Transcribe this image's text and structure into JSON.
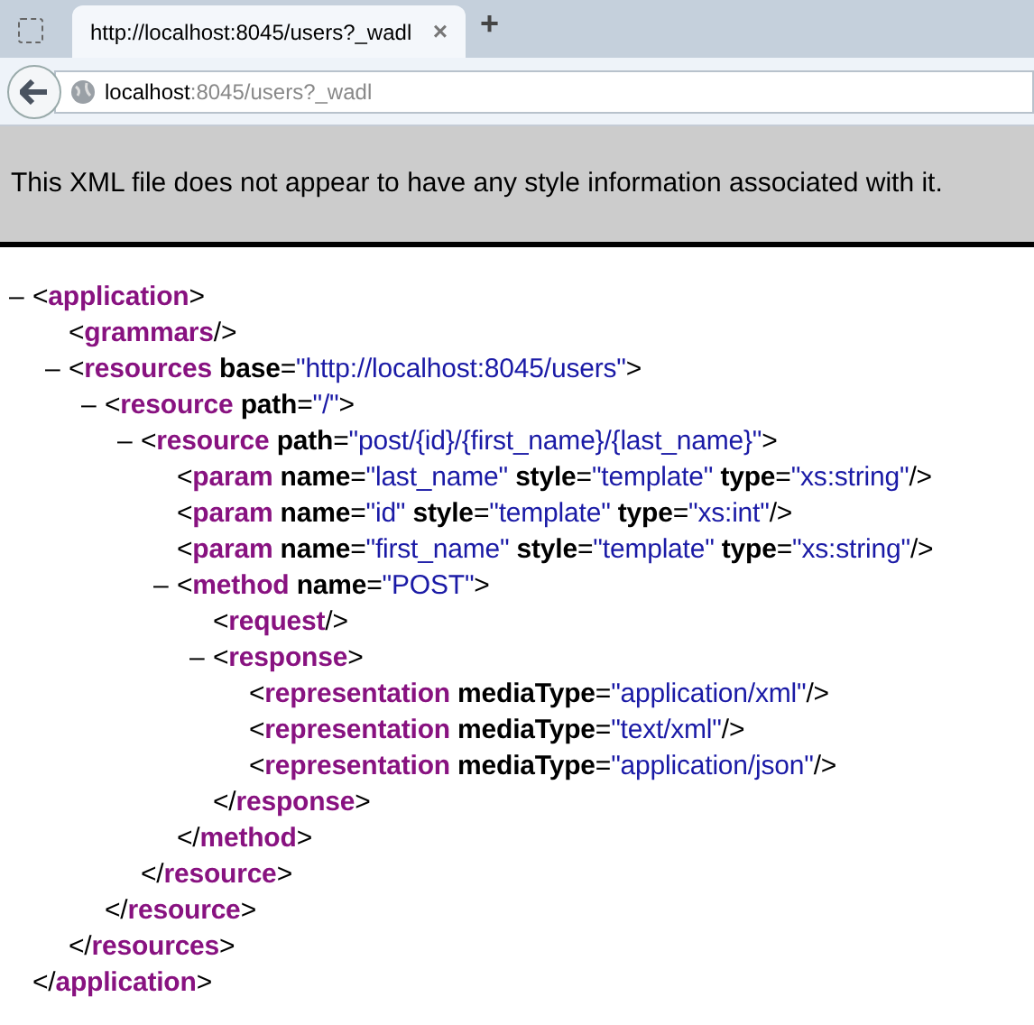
{
  "tab": {
    "title": "http://localhost:8045/users?_wadl",
    "close": "×",
    "selected": true
  },
  "new_tab": "+",
  "address": {
    "host": "localhost",
    "rest": ":8045/users?_wadl"
  },
  "info_bar": "This XML file does not appear to have any style information associated with it.",
  "tree": [
    {
      "toggle": "–",
      "tokens": [
        {
          "kind": "punct",
          "text": "<"
        },
        {
          "kind": "tag",
          "text": "application"
        },
        {
          "kind": "punct",
          "text": ">"
        }
      ],
      "end": [
        {
          "kind": "punct",
          "text": "</"
        },
        {
          "kind": "tag",
          "text": "application"
        },
        {
          "kind": "punct",
          "text": ">"
        }
      ],
      "children": [
        {
          "tokens": [
            {
              "kind": "punct",
              "text": "<"
            },
            {
              "kind": "tag",
              "text": "grammars"
            },
            {
              "kind": "punct",
              "text": "/>"
            }
          ]
        },
        {
          "toggle": "–",
          "tokens": [
            {
              "kind": "punct",
              "text": "<"
            },
            {
              "kind": "tag",
              "text": "resources"
            },
            {
              "kind": "attr",
              "text": "base"
            },
            {
              "kind": "punct",
              "text": "="
            },
            {
              "kind": "value",
              "text": "\"http://localhost:8045/users\""
            },
            {
              "kind": "punct",
              "text": ">"
            }
          ],
          "end": [
            {
              "kind": "punct",
              "text": "</"
            },
            {
              "kind": "tag",
              "text": "resources"
            },
            {
              "kind": "punct",
              "text": ">"
            }
          ],
          "children": [
            {
              "toggle": "–",
              "tokens": [
                {
                  "kind": "punct",
                  "text": "<"
                },
                {
                  "kind": "tag",
                  "text": "resource"
                },
                {
                  "kind": "attr",
                  "text": "path"
                },
                {
                  "kind": "punct",
                  "text": "="
                },
                {
                  "kind": "value",
                  "text": "\"/\""
                },
                {
                  "kind": "punct",
                  "text": ">"
                }
              ],
              "end": [
                {
                  "kind": "punct",
                  "text": "</"
                },
                {
                  "kind": "tag",
                  "text": "resource"
                },
                {
                  "kind": "punct",
                  "text": ">"
                }
              ],
              "children": [
                {
                  "toggle": "–",
                  "tokens": [
                    {
                      "kind": "punct",
                      "text": "<"
                    },
                    {
                      "kind": "tag",
                      "text": "resource"
                    },
                    {
                      "kind": "attr",
                      "text": "path"
                    },
                    {
                      "kind": "punct",
                      "text": "="
                    },
                    {
                      "kind": "value",
                      "text": "\"post/{id}/{first_name}/{last_name}\""
                    },
                    {
                      "kind": "punct",
                      "text": ">"
                    }
                  ],
                  "end": [
                    {
                      "kind": "punct",
                      "text": "</"
                    },
                    {
                      "kind": "tag",
                      "text": "resource"
                    },
                    {
                      "kind": "punct",
                      "text": ">"
                    }
                  ],
                  "children": [
                    {
                      "tokens": [
                        {
                          "kind": "punct",
                          "text": "<"
                        },
                        {
                          "kind": "tag",
                          "text": "param"
                        },
                        {
                          "kind": "attr",
                          "text": "name"
                        },
                        {
                          "kind": "punct",
                          "text": "="
                        },
                        {
                          "kind": "value",
                          "text": "\"last_name\""
                        },
                        {
                          "kind": "attr",
                          "text": "style"
                        },
                        {
                          "kind": "punct",
                          "text": "="
                        },
                        {
                          "kind": "value",
                          "text": "\"template\""
                        },
                        {
                          "kind": "attr",
                          "text": "type"
                        },
                        {
                          "kind": "punct",
                          "text": "="
                        },
                        {
                          "kind": "value",
                          "text": "\"xs:string\""
                        },
                        {
                          "kind": "punct",
                          "text": "/>"
                        }
                      ]
                    },
                    {
                      "tokens": [
                        {
                          "kind": "punct",
                          "text": "<"
                        },
                        {
                          "kind": "tag",
                          "text": "param"
                        },
                        {
                          "kind": "attr",
                          "text": "name"
                        },
                        {
                          "kind": "punct",
                          "text": "="
                        },
                        {
                          "kind": "value",
                          "text": "\"id\""
                        },
                        {
                          "kind": "attr",
                          "text": "style"
                        },
                        {
                          "kind": "punct",
                          "text": "="
                        },
                        {
                          "kind": "value",
                          "text": "\"template\""
                        },
                        {
                          "kind": "attr",
                          "text": "type"
                        },
                        {
                          "kind": "punct",
                          "text": "="
                        },
                        {
                          "kind": "value",
                          "text": "\"xs:int\""
                        },
                        {
                          "kind": "punct",
                          "text": "/>"
                        }
                      ]
                    },
                    {
                      "tokens": [
                        {
                          "kind": "punct",
                          "text": "<"
                        },
                        {
                          "kind": "tag",
                          "text": "param"
                        },
                        {
                          "kind": "attr",
                          "text": "name"
                        },
                        {
                          "kind": "punct",
                          "text": "="
                        },
                        {
                          "kind": "value",
                          "text": "\"first_name\""
                        },
                        {
                          "kind": "attr",
                          "text": "style"
                        },
                        {
                          "kind": "punct",
                          "text": "="
                        },
                        {
                          "kind": "value",
                          "text": "\"template\""
                        },
                        {
                          "kind": "attr",
                          "text": "type"
                        },
                        {
                          "kind": "punct",
                          "text": "="
                        },
                        {
                          "kind": "value",
                          "text": "\"xs:string\""
                        },
                        {
                          "kind": "punct",
                          "text": "/>"
                        }
                      ]
                    },
                    {
                      "toggle": "–",
                      "tokens": [
                        {
                          "kind": "punct",
                          "text": "<"
                        },
                        {
                          "kind": "tag",
                          "text": "method"
                        },
                        {
                          "kind": "attr",
                          "text": "name"
                        },
                        {
                          "kind": "punct",
                          "text": "="
                        },
                        {
                          "kind": "value",
                          "text": "\"POST\""
                        },
                        {
                          "kind": "punct",
                          "text": ">"
                        }
                      ],
                      "end": [
                        {
                          "kind": "punct",
                          "text": "</"
                        },
                        {
                          "kind": "tag",
                          "text": "method"
                        },
                        {
                          "kind": "punct",
                          "text": ">"
                        }
                      ],
                      "children": [
                        {
                          "tokens": [
                            {
                              "kind": "punct",
                              "text": "<"
                            },
                            {
                              "kind": "tag",
                              "text": "request"
                            },
                            {
                              "kind": "punct",
                              "text": "/>"
                            }
                          ]
                        },
                        {
                          "toggle": "–",
                          "tokens": [
                            {
                              "kind": "punct",
                              "text": "<"
                            },
                            {
                              "kind": "tag",
                              "text": "response"
                            },
                            {
                              "kind": "punct",
                              "text": ">"
                            }
                          ],
                          "end": [
                            {
                              "kind": "punct",
                              "text": "</"
                            },
                            {
                              "kind": "tag",
                              "text": "response"
                            },
                            {
                              "kind": "punct",
                              "text": ">"
                            }
                          ],
                          "children": [
                            {
                              "tokens": [
                                {
                                  "kind": "punct",
                                  "text": "<"
                                },
                                {
                                  "kind": "tag",
                                  "text": "representation"
                                },
                                {
                                  "kind": "attr",
                                  "text": "mediaType"
                                },
                                {
                                  "kind": "punct",
                                  "text": "="
                                },
                                {
                                  "kind": "value",
                                  "text": "\"application/xml\""
                                },
                                {
                                  "kind": "punct",
                                  "text": "/>"
                                }
                              ]
                            },
                            {
                              "tokens": [
                                {
                                  "kind": "punct",
                                  "text": "<"
                                },
                                {
                                  "kind": "tag",
                                  "text": "representation"
                                },
                                {
                                  "kind": "attr",
                                  "text": "mediaType"
                                },
                                {
                                  "kind": "punct",
                                  "text": "="
                                },
                                {
                                  "kind": "value",
                                  "text": "\"text/xml\""
                                },
                                {
                                  "kind": "punct",
                                  "text": "/>"
                                }
                              ]
                            },
                            {
                              "tokens": [
                                {
                                  "kind": "punct",
                                  "text": "<"
                                },
                                {
                                  "kind": "tag",
                                  "text": "representation"
                                },
                                {
                                  "kind": "attr",
                                  "text": "mediaType"
                                },
                                {
                                  "kind": "punct",
                                  "text": "="
                                },
                                {
                                  "kind": "value",
                                  "text": "\"application/json\""
                                },
                                {
                                  "kind": "punct",
                                  "text": "/>"
                                }
                              ]
                            }
                          ]
                        }
                      ]
                    }
                  ]
                }
              ]
            }
          ]
        }
      ]
    }
  ]
}
